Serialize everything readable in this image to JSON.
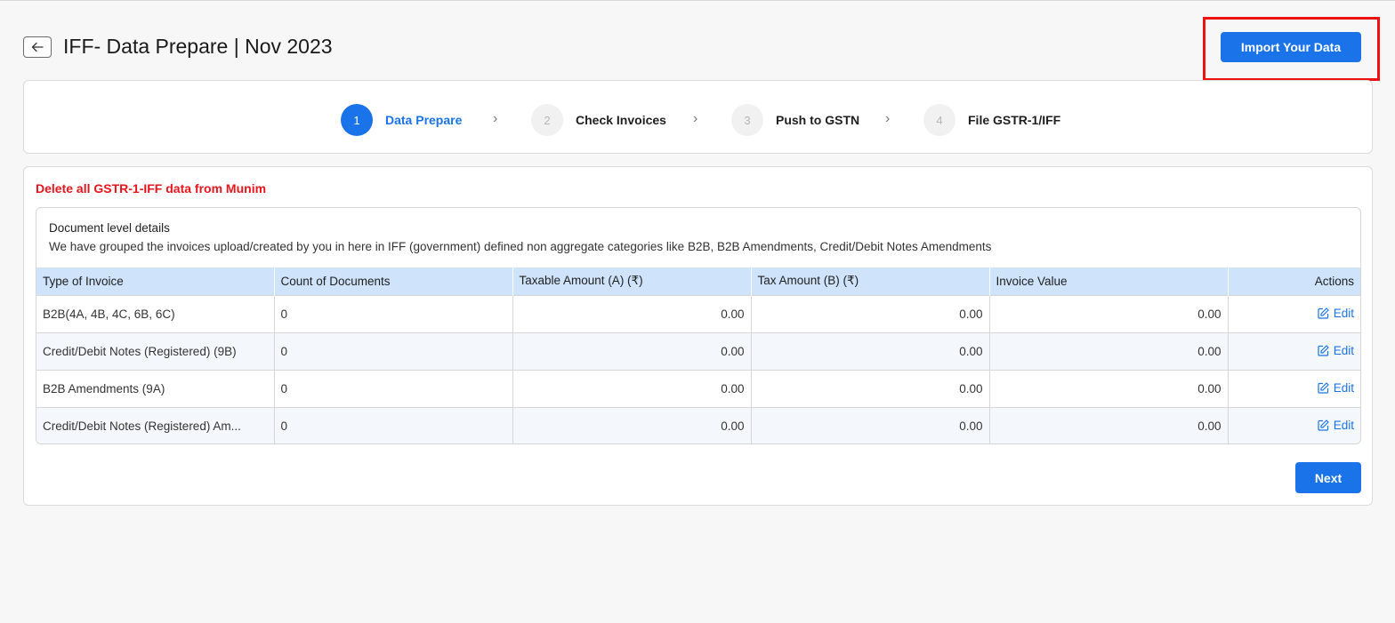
{
  "header": {
    "title": "IFF- Data Prepare | Nov 2023",
    "back_icon": "arrow-left-icon",
    "import_button": "Import Your Data"
  },
  "stepper": {
    "steps": [
      {
        "number": "1",
        "label": "Data Prepare",
        "active": true
      },
      {
        "number": "2",
        "label": "Check Invoices",
        "active": false
      },
      {
        "number": "3",
        "label": "Push to GSTN",
        "active": false
      },
      {
        "number": "4",
        "label": "File GSTR-1/IFF",
        "active": false
      }
    ],
    "separator": "›"
  },
  "main": {
    "delete_link": "Delete all GSTR-1-IFF data from Munim",
    "doc_title": "Document level details",
    "doc_description": "We have grouped the invoices upload/created by you in here in IFF (government) defined non aggregate categories like B2B, B2B Amendments, Credit/Debit Notes Amendments",
    "table": {
      "headers": [
        "Type of Invoice",
        "Count of Documents",
        "Taxable Amount (A) (₹)",
        "Tax Amount (B) (₹)",
        "Invoice Value",
        "Actions"
      ],
      "rows": [
        {
          "type": "B2B(4A, 4B, 4C, 6B, 6C)",
          "count": "0",
          "taxable": "0.00",
          "tax": "0.00",
          "value": "0.00",
          "action": "Edit"
        },
        {
          "type": "Credit/Debit Notes (Registered) (9B)",
          "count": "0",
          "taxable": "0.00",
          "tax": "0.00",
          "value": "0.00",
          "action": "Edit"
        },
        {
          "type": "B2B Amendments (9A)",
          "count": "0",
          "taxable": "0.00",
          "tax": "0.00",
          "value": "0.00",
          "action": "Edit"
        },
        {
          "type": "Credit/Debit Notes (Registered) Am...",
          "count": "0",
          "taxable": "0.00",
          "tax": "0.00",
          "value": "0.00",
          "action": "Edit"
        }
      ]
    },
    "next_button": "Next"
  },
  "colors": {
    "accent": "#1a73e8",
    "danger": "#e8141c",
    "highlight": "#ee1111",
    "table_header": "#cfe3fb"
  }
}
